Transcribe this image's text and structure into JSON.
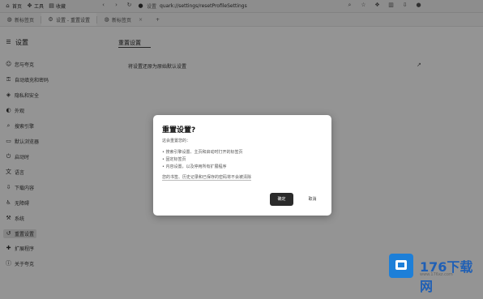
{
  "browser": {
    "toolbar_items": [
      {
        "icon": "home-icon",
        "label": "首页"
      },
      {
        "icon": "tools-icon",
        "label": "工具"
      },
      {
        "icon": "bookmark-icon",
        "label": "收藏"
      }
    ],
    "url_site": "设置",
    "url": "quark://settings/resetProfileSettings",
    "tabs": [
      {
        "label": "新标签页",
        "icon": "globe-icon"
      },
      {
        "label": "设置 - 重置设置",
        "icon": "settings-icon"
      },
      {
        "label": "新标签页",
        "icon": "globe-icon"
      }
    ],
    "new_tab_symbol": "+"
  },
  "sidebar": {
    "title": "设置",
    "items": [
      {
        "label": "您与夸克",
        "icon": "user-icon"
      },
      {
        "label": "自动填充和密码",
        "icon": "key-icon"
      },
      {
        "label": "隐私和安全",
        "icon": "shield-icon"
      },
      {
        "label": "外观",
        "icon": "palette-icon"
      },
      {
        "label": "搜索引擎",
        "icon": "search-icon"
      },
      {
        "label": "默认浏览器",
        "icon": "browser-icon"
      },
      {
        "label": "启动时",
        "icon": "power-icon"
      },
      {
        "label": "语言",
        "icon": "language-icon"
      },
      {
        "label": "下载内容",
        "icon": "download-icon"
      },
      {
        "label": "无障碍",
        "icon": "accessibility-icon"
      },
      {
        "label": "系统",
        "icon": "wrench-icon"
      },
      {
        "label": "重置设置",
        "icon": "reset-icon",
        "active": true
      },
      {
        "label": "扩展程序",
        "icon": "puzzle-icon"
      },
      {
        "label": "关于夸克",
        "icon": "info-icon"
      }
    ]
  },
  "content": {
    "title": "重置设置",
    "row_label": "将设置还原为原始默认设置",
    "row_arrow": "↗"
  },
  "dialog": {
    "title": "重置设置?",
    "subtitle": "这会重置您的：",
    "bullets": [
      "搜索引擎设置、主页和启动时打开的标签页",
      "固定标签页",
      "内容设置，以及停用所有扩展程序"
    ],
    "note": "您的书签、历史记录和已保存的密码将不会被清除",
    "confirm_label": "确定",
    "cancel_label": "取消"
  },
  "watermark": {
    "brand": "176下载网",
    "url": "www.176xz.com"
  },
  "colors": {
    "overlay": "#000000",
    "confirm_bg": "#2b2b2b",
    "watermark_blue": "#1d7fd8"
  }
}
